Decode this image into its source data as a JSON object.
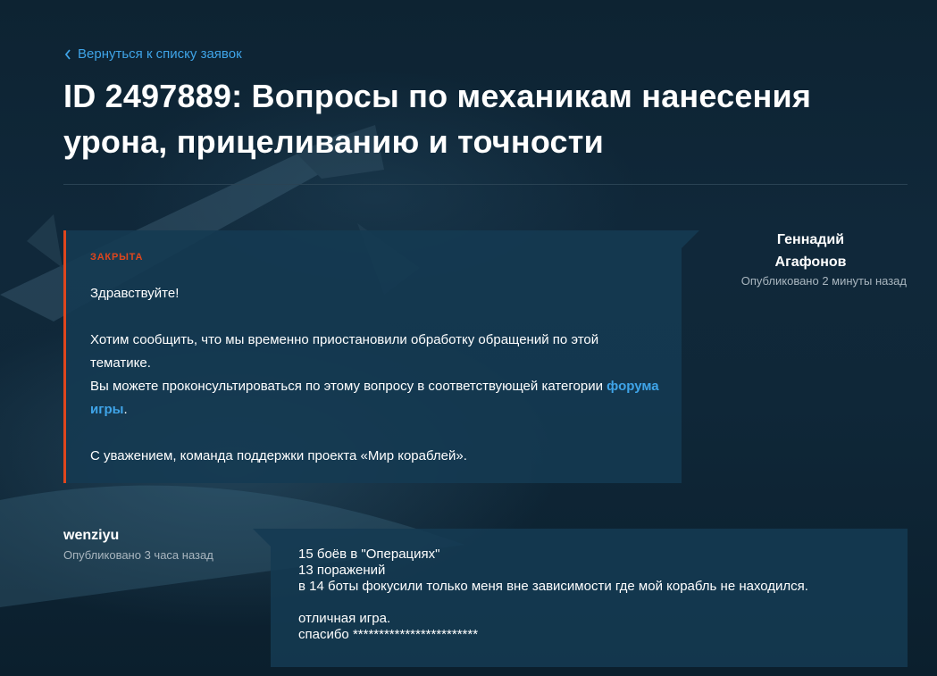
{
  "back_link": {
    "label": "Вернуться к списку заявок"
  },
  "title": "ID 2497889: Вопросы по механикам нанесения урона, прицеливанию и точности",
  "reply": {
    "status": "ЗАКРЫТА",
    "author_first": "Геннадий",
    "author_last": "Агафонов",
    "published": "Опубликовано 2 минуты назад",
    "greeting": "Здравствуйте!",
    "para1": "Хотим сообщить, что мы временно приостановили обработку обращений по этой тематике.",
    "para2_start": "Вы можете проконсультироваться по этому вопросу в соответствующей категории ",
    "forum_link": "форума игры",
    "para2_end": ".",
    "signature": "С уважением, команда поддержки проекта «Мир кораблей»."
  },
  "user_message": {
    "author": "wenziyu",
    "published": "Опубликовано 3 часа назад",
    "line1": "15 боёв в \"Операциях\"",
    "line2": "13 поражений",
    "line3": "в 14 боты фокусили только меня вне зависимости где мой корабль не находился.",
    "line4": "отличная игра.",
    "line5": "спасибо ************************"
  },
  "colors": {
    "accent_link": "#3fa4e8",
    "status_closed": "#e0461d",
    "card_bg": "#143a52",
    "page_bg": "#0f2738"
  }
}
